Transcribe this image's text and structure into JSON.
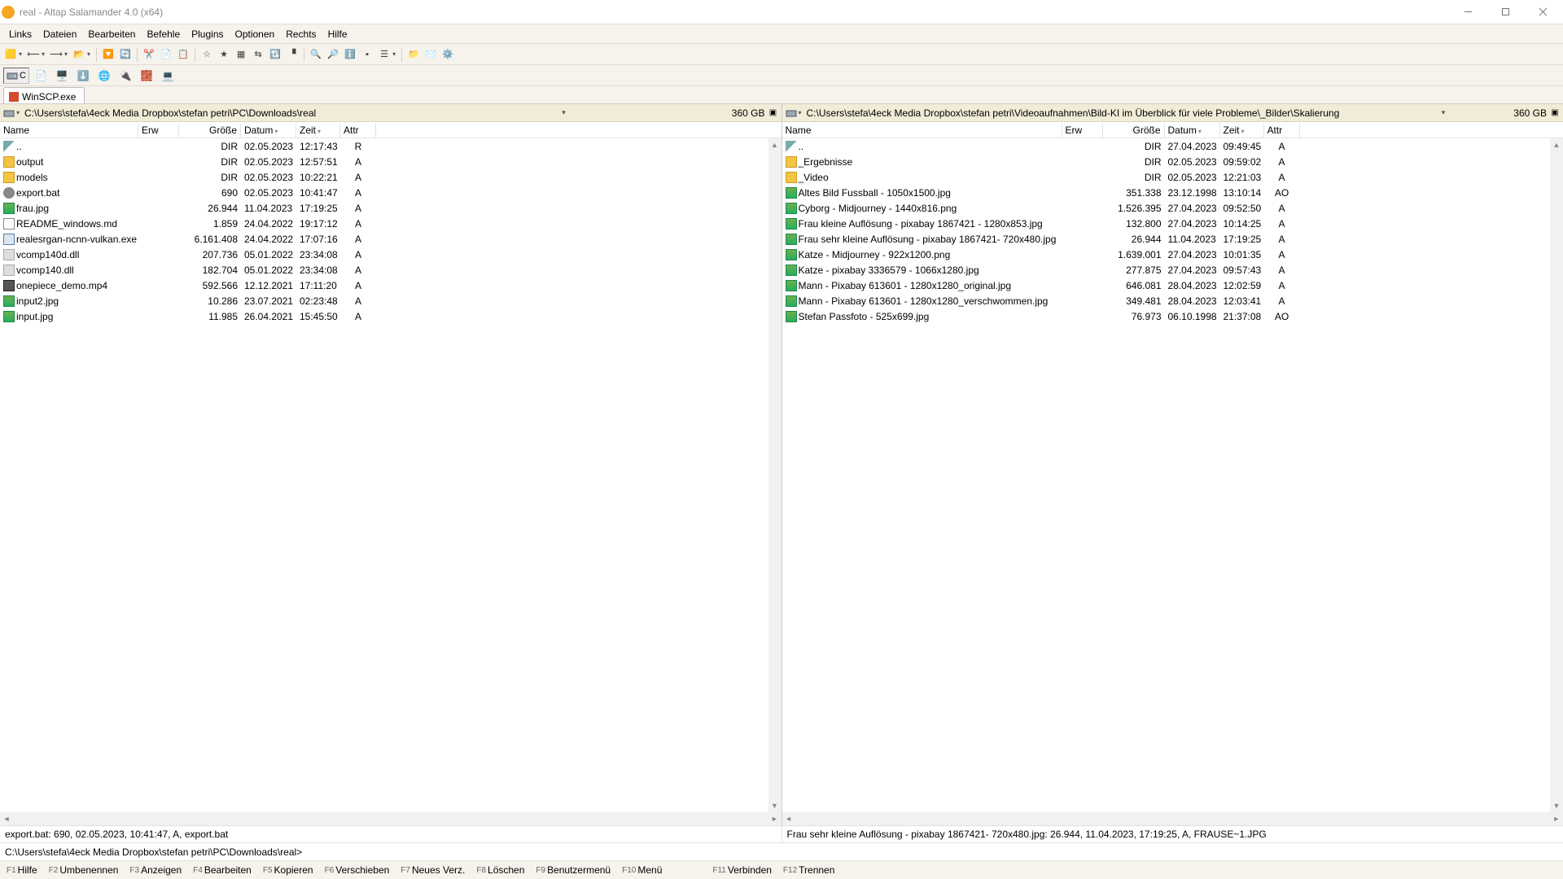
{
  "window": {
    "title": "real - Altap Salamander 4.0 (x64)"
  },
  "menu": {
    "items": [
      "Links",
      "Dateien",
      "Bearbeiten",
      "Befehle",
      "Plugins",
      "Optionen",
      "Rechts",
      "Hilfe"
    ]
  },
  "drivebar": {
    "c_label": "C"
  },
  "plugin_tab": {
    "label": "WinSCP.exe"
  },
  "columns": {
    "name": "Name",
    "ext": "Erw",
    "size": "Größe",
    "date": "Datum",
    "time": "Zeit",
    "attr": "Attr"
  },
  "left": {
    "path": "C:\\Users\\stefa\\4eck Media Dropbox\\stefan petri\\PC\\Downloads\\real",
    "free": "360 GB",
    "rows": [
      {
        "icon": "up",
        "name": "..",
        "size": "DIR",
        "date": "02.05.2023",
        "time": "12:17:43",
        "attr": "R"
      },
      {
        "icon": "folder",
        "name": "output",
        "size": "DIR",
        "date": "02.05.2023",
        "time": "12:57:51",
        "attr": "A"
      },
      {
        "icon": "folder",
        "name": "models",
        "size": "DIR",
        "date": "02.05.2023",
        "time": "10:22:21",
        "attr": "A"
      },
      {
        "icon": "gear",
        "name": "export.bat",
        "size": "690",
        "date": "02.05.2023",
        "time": "10:41:47",
        "attr": "A"
      },
      {
        "icon": "img",
        "name": "frau.jpg",
        "size": "26.944",
        "date": "11.04.2023",
        "time": "17:19:25",
        "attr": "A"
      },
      {
        "icon": "txt",
        "name": "README_windows.md",
        "size": "1.859",
        "date": "24.04.2022",
        "time": "19:17:12",
        "attr": "A"
      },
      {
        "icon": "exe",
        "name": "realesrgan-ncnn-vulkan.exe",
        "size": "6.161.408",
        "date": "24.04.2022",
        "time": "17:07:16",
        "attr": "A"
      },
      {
        "icon": "dll",
        "name": "vcomp140d.dll",
        "size": "207.736",
        "date": "05.01.2022",
        "time": "23:34:08",
        "attr": "A"
      },
      {
        "icon": "dll",
        "name": "vcomp140.dll",
        "size": "182.704",
        "date": "05.01.2022",
        "time": "23:34:08",
        "attr": "A"
      },
      {
        "icon": "vid",
        "name": "onepiece_demo.mp4",
        "size": "592.566",
        "date": "12.12.2021",
        "time": "17:11:20",
        "attr": "A"
      },
      {
        "icon": "img",
        "name": "input2.jpg",
        "size": "10.286",
        "date": "23.07.2021",
        "time": "02:23:48",
        "attr": "A"
      },
      {
        "icon": "img",
        "name": "input.jpg",
        "size": "11.985",
        "date": "26.04.2021",
        "time": "15:45:50",
        "attr": "A"
      }
    ]
  },
  "right": {
    "path": "C:\\Users\\stefa\\4eck Media Dropbox\\stefan petri\\Videoaufnahmen\\Bild-KI im Überblick für viele Probleme\\_Bilder\\Skalierung",
    "free": "360 GB",
    "rows": [
      {
        "icon": "up",
        "name": "..",
        "size": "DIR",
        "date": "27.04.2023",
        "time": "09:49:45",
        "attr": "A"
      },
      {
        "icon": "folder",
        "name": "_Ergebnisse",
        "size": "DIR",
        "date": "02.05.2023",
        "time": "09:59:02",
        "attr": "A"
      },
      {
        "icon": "folder",
        "name": "_Video",
        "size": "DIR",
        "date": "02.05.2023",
        "time": "12:21:03",
        "attr": "A"
      },
      {
        "icon": "img",
        "name": "Altes Bild Fussball - 1050x1500.jpg",
        "size": "351.338",
        "date": "23.12.1998",
        "time": "13:10:14",
        "attr": "AO"
      },
      {
        "icon": "img",
        "name": "Cyborg - Midjourney - 1440x816.png",
        "size": "1.526.395",
        "date": "27.04.2023",
        "time": "09:52:50",
        "attr": "A"
      },
      {
        "icon": "img",
        "name": "Frau kleine Auflösung - pixabay 1867421 - 1280x853.jpg",
        "size": "132.800",
        "date": "27.04.2023",
        "time": "10:14:25",
        "attr": "A"
      },
      {
        "icon": "img",
        "name": "Frau sehr kleine Auflösung - pixabay 1867421- 720x480.jpg",
        "size": "26.944",
        "date": "11.04.2023",
        "time": "17:19:25",
        "attr": "A"
      },
      {
        "icon": "img",
        "name": "Katze - Midjourney - 922x1200.png",
        "size": "1.639.001",
        "date": "27.04.2023",
        "time": "10:01:35",
        "attr": "A"
      },
      {
        "icon": "img",
        "name": "Katze - pixabay 3336579 - 1066x1280.jpg",
        "size": "277.875",
        "date": "27.04.2023",
        "time": "09:57:43",
        "attr": "A"
      },
      {
        "icon": "img",
        "name": "Mann - Pixabay 613601 - 1280x1280_original.jpg",
        "size": "646.081",
        "date": "28.04.2023",
        "time": "12:02:59",
        "attr": "A"
      },
      {
        "icon": "img",
        "name": "Mann - Pixabay 613601 - 1280x1280_verschwommen.jpg",
        "size": "349.481",
        "date": "28.04.2023",
        "time": "12:03:41",
        "attr": "A"
      },
      {
        "icon": "img",
        "name": "Stefan Passfoto - 525x699.jpg",
        "size": "76.973",
        "date": "06.10.1998",
        "time": "21:37:08",
        "attr": "AO"
      }
    ]
  },
  "status": {
    "left": "export.bat: 690, 02.05.2023, 10:41:47, A, export.bat",
    "right": "Frau sehr kleine Auflösung - pixabay 1867421- 720x480.jpg: 26.944, 11.04.2023, 17:19:25, A, FRAUSE~1.JPG"
  },
  "cmdline": {
    "prompt": "C:\\Users\\stefa\\4eck Media Dropbox\\stefan petri\\PC\\Downloads\\real>"
  },
  "fkeys": [
    {
      "key": "F1",
      "label": "Hilfe"
    },
    {
      "key": "F2",
      "label": "Umbenennen"
    },
    {
      "key": "F3",
      "label": "Anzeigen"
    },
    {
      "key": "F4",
      "label": "Bearbeiten"
    },
    {
      "key": "F5",
      "label": "Kopieren"
    },
    {
      "key": "F6",
      "label": "Verschieben"
    },
    {
      "key": "F7",
      "label": "Neues Verz."
    },
    {
      "key": "F8",
      "label": "Löschen"
    },
    {
      "key": "F9",
      "label": "Benutzermenü"
    },
    {
      "key": "F10",
      "label": "Menü"
    },
    {
      "key": "F11",
      "label": "Verbinden"
    },
    {
      "key": "F12",
      "label": "Trennen"
    }
  ]
}
